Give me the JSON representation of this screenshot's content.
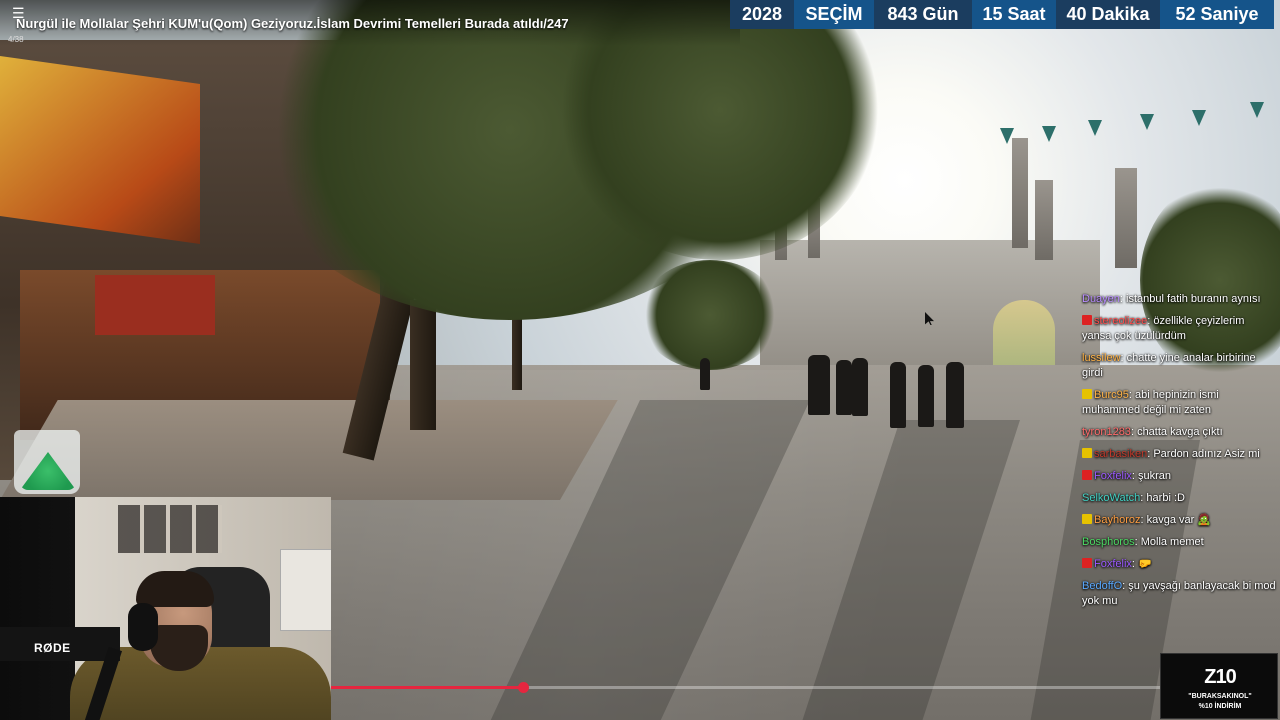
{
  "video": {
    "title": "Nurgül ile Mollalar Şehri KUM'u(Qom) Geziyoruz.İslam Devrimi Temelleri Burada atıldı/247",
    "menu_glyph": "☰",
    "page_counter": "4/38",
    "progress_fraction": 0.232
  },
  "countdown": {
    "year": "2028",
    "label": "SEÇİM",
    "days": "843 Gün",
    "hours": "15 Saat",
    "minutes": "40 Dakika",
    "seconds": "52 Saniye"
  },
  "chat": [
    {
      "name": "Duayen",
      "color": "#b98cff",
      "badge": "",
      "message": "istanbul fatih buranın aynısı"
    },
    {
      "name": "stereolizee",
      "color": "#ff4b4b",
      "badge": "#d22",
      "message": "özellikle çeyizlerim yansa çok üzülürdüm"
    },
    {
      "name": "lussilew",
      "color": "#ffb347",
      "badge": "",
      "message": "chatte yine analar birbirine girdi"
    },
    {
      "name": "Burc95",
      "color": "#ffb347",
      "badge": "#e6c200",
      "message": "abi hepinizin ismi muhammed değil mi zaten"
    },
    {
      "name": "tyron1283",
      "color": "#ff6b6b",
      "badge": "",
      "message": "chatta kavga çıktı"
    },
    {
      "name": "sarbasiken",
      "color": "#c0392b",
      "badge": "#e6c200",
      "message": "Pardon adınız Asiz mi"
    },
    {
      "name": "Foxfelix",
      "color": "#9b59ff",
      "badge": "#d22",
      "message": "şukran"
    },
    {
      "name": "SelkoWatch",
      "color": "#41d1c4",
      "badge": "",
      "message": "harbi :D"
    },
    {
      "name": "Bayhoroz",
      "color": "#ff9f43",
      "badge": "#e6c200",
      "message": "kavga var 🧟"
    },
    {
      "name": "Bosphoros",
      "color": "#4cd964",
      "badge": "",
      "message": "Molla memet"
    },
    {
      "name": "Foxfelix",
      "color": "#9b59ff",
      "badge": "#d22",
      "message": "🤛"
    },
    {
      "name": "BedoffO",
      "color": "#5aa9ff",
      "badge": "",
      "message": "şu yavşağı banlayacak bi mod yok mu"
    }
  ],
  "webcam": {
    "mic_brand": "RØDE"
  },
  "sponsor": {
    "logo": "Z10",
    "code": "\"BURAKSAKINOL\"",
    "discount": "%10 İNDİRİM"
  },
  "colors": {
    "progress": "#e5263f",
    "countdown_dark": "#1b3d5f",
    "countdown_light": "#15548a"
  }
}
